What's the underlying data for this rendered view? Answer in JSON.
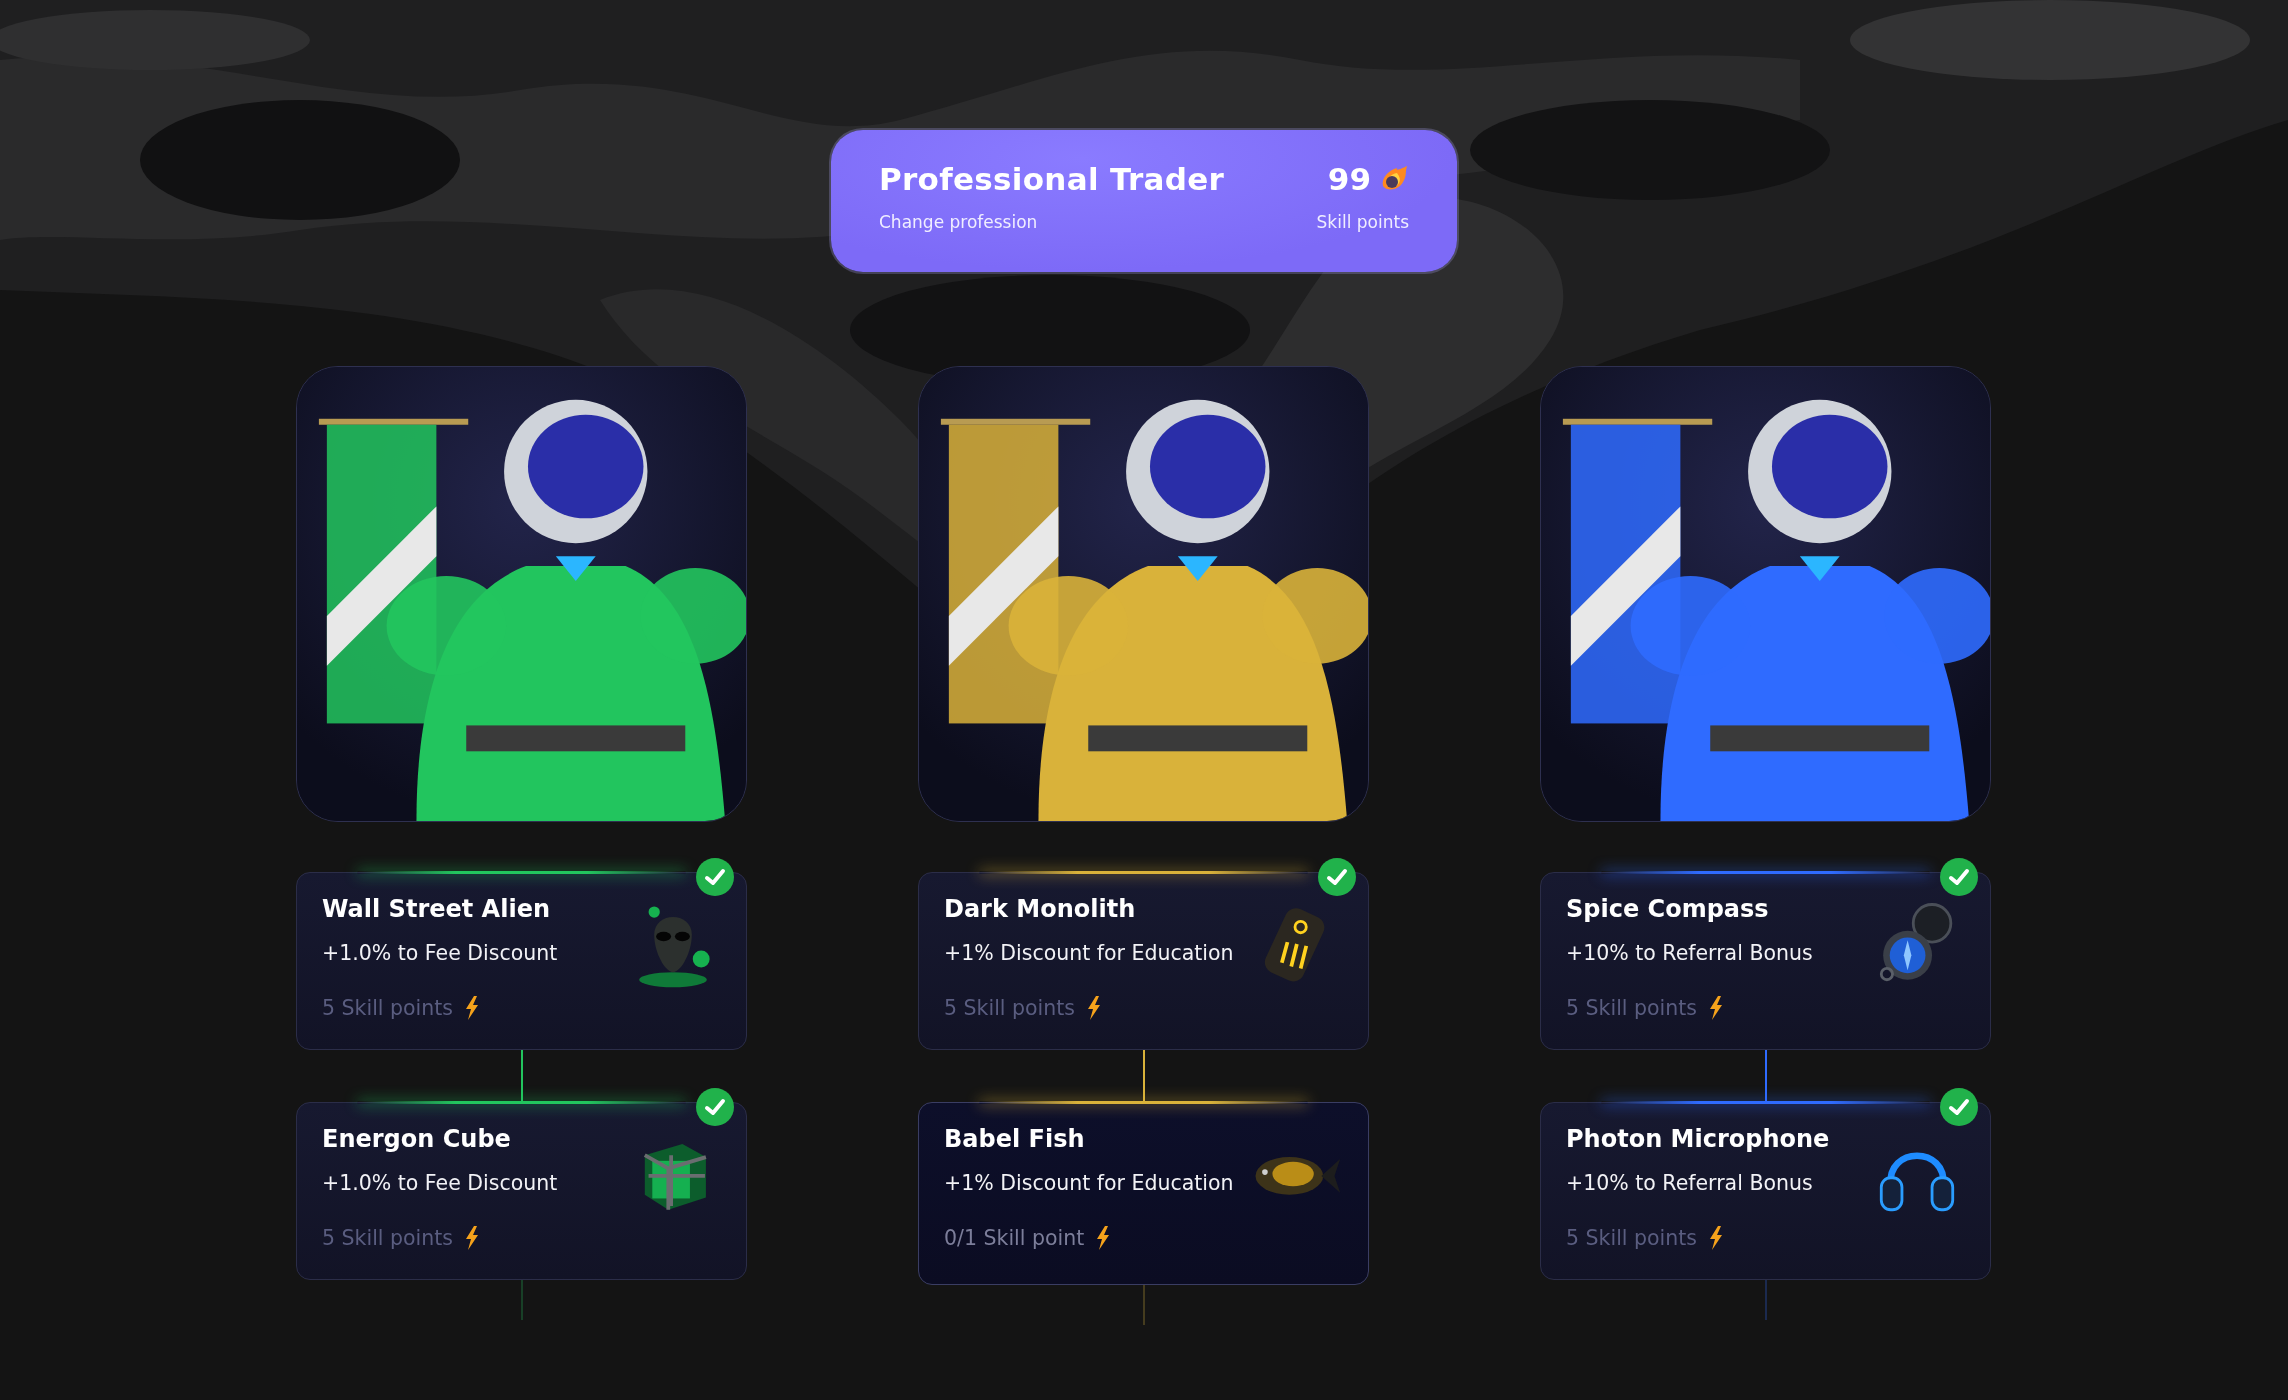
{
  "header": {
    "title": "Professional Trader",
    "link": "Change profession",
    "points": "99",
    "points_label": "Skill points"
  },
  "columns": [
    {
      "color": "#22c55e",
      "items": [
        {
          "title": "Wall Street Alien",
          "bonus": "+1.0% to Fee Discount",
          "cost": "5 Skill points",
          "checked": true
        },
        {
          "title": "Energon Cube",
          "bonus": "+1.0% to Fee Discount",
          "cost": "5 Skill points",
          "checked": true
        }
      ]
    },
    {
      "color": "#d9b23a",
      "items": [
        {
          "title": "Dark Monolith",
          "bonus": "+1% Discount for Education",
          "cost": "5 Skill points",
          "checked": true
        },
        {
          "title": "Babel Fish",
          "bonus": "+1% Discount for Education",
          "cost": "0/1 Skill point",
          "checked": false
        }
      ]
    },
    {
      "color": "#2f6bff",
      "items": [
        {
          "title": "Spice Compass",
          "bonus": "+10% to Referral Bonus",
          "cost": "5 Skill points",
          "checked": true
        },
        {
          "title": "Photon Microphone",
          "bonus": "+10% to Referral Bonus",
          "cost": "5 Skill points",
          "checked": true
        }
      ]
    }
  ]
}
